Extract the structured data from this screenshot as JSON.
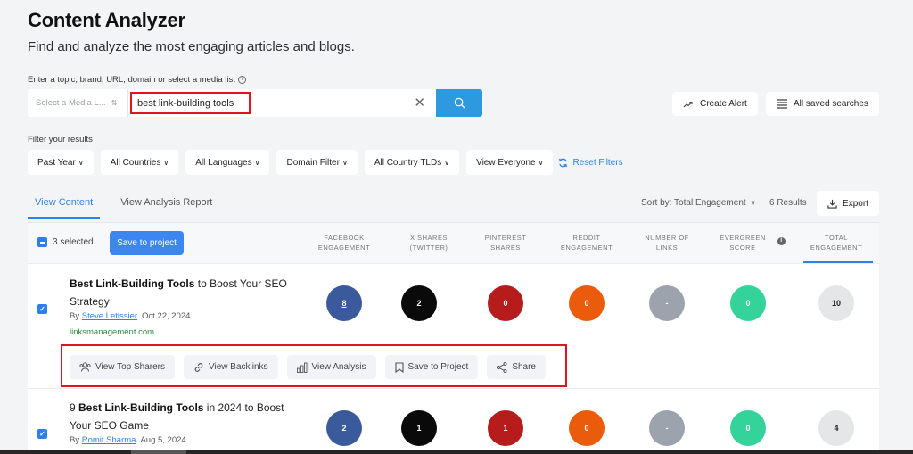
{
  "header": {
    "title": "Content Analyzer",
    "subtitle": "Find and analyze the most engaging articles and blogs."
  },
  "search": {
    "label": "Enter a topic, brand, URL, domain or select a media list",
    "media_select_placeholder": "Select a Media L...",
    "query": "best link-building tools",
    "icons": {
      "info": "info-icon",
      "clear": "close-icon",
      "submit": "search-icon"
    }
  },
  "top_actions": {
    "create_alert": "Create Alert",
    "saved_searches": "All saved searches"
  },
  "filters": {
    "label": "Filter your results",
    "items": [
      "Past Year",
      "All Countries",
      "All Languages",
      "Domain Filter",
      "All Country TLDs",
      "View Everyone"
    ],
    "reset": "Reset Filters"
  },
  "tabs": [
    {
      "label": "View Content",
      "active": true
    },
    {
      "label": "View Analysis Report",
      "active": false
    }
  ],
  "toolbar": {
    "sort_label": "Sort by: Total Engagement",
    "results_count": "6 Results",
    "export_label": "Export"
  },
  "table": {
    "selected_text": "3 selected",
    "save_to_project": "Save to project",
    "columns": [
      {
        "line1": "FACEBOOK",
        "line2": "ENGAGEMENT"
      },
      {
        "line1": "X SHARES",
        "line2": "(TWITTER)"
      },
      {
        "line1": "PINTEREST",
        "line2": "SHARES"
      },
      {
        "line1": "REDDIT",
        "line2": "ENGAGEMENT"
      },
      {
        "line1": "NUMBER OF",
        "line2": "LINKS"
      },
      {
        "line1": "EVERGREEN",
        "line2": "SCORE"
      },
      {
        "line1": "TOTAL",
        "line2": "ENGAGEMENT"
      }
    ],
    "metric_colors": [
      "#3a5a9b",
      "#0a0a0a",
      "#b71c1c",
      "#ea5b0c",
      "#9ca3ad",
      "#34d399",
      "#e5e6e8"
    ],
    "rows": [
      {
        "checked": true,
        "title_bold": "Best Link-Building Tools",
        "title_rest": " to Boost Your SEO Strategy",
        "title_prefix": "",
        "by": "By",
        "author": "Steve Letissier",
        "date": "Oct 22, 2024",
        "domain": "linksmanagement.com",
        "metrics": [
          "8",
          "2",
          "0",
          "0",
          "-",
          "0",
          "10"
        ]
      },
      {
        "checked": true,
        "title_prefix": "9 ",
        "title_bold": "Best Link-Building Tools",
        "title_rest": " in 2024 to Boost Your SEO Game",
        "by": "By",
        "author": "Romit Sharma",
        "date": "Aug 5, 2024",
        "metrics": [
          "2",
          "1",
          "1",
          "0",
          "-",
          "0",
          "4"
        ]
      }
    ],
    "row_actions": [
      "View Top Sharers",
      "View Backlinks",
      "View Analysis",
      "Save to Project",
      "Share"
    ]
  }
}
